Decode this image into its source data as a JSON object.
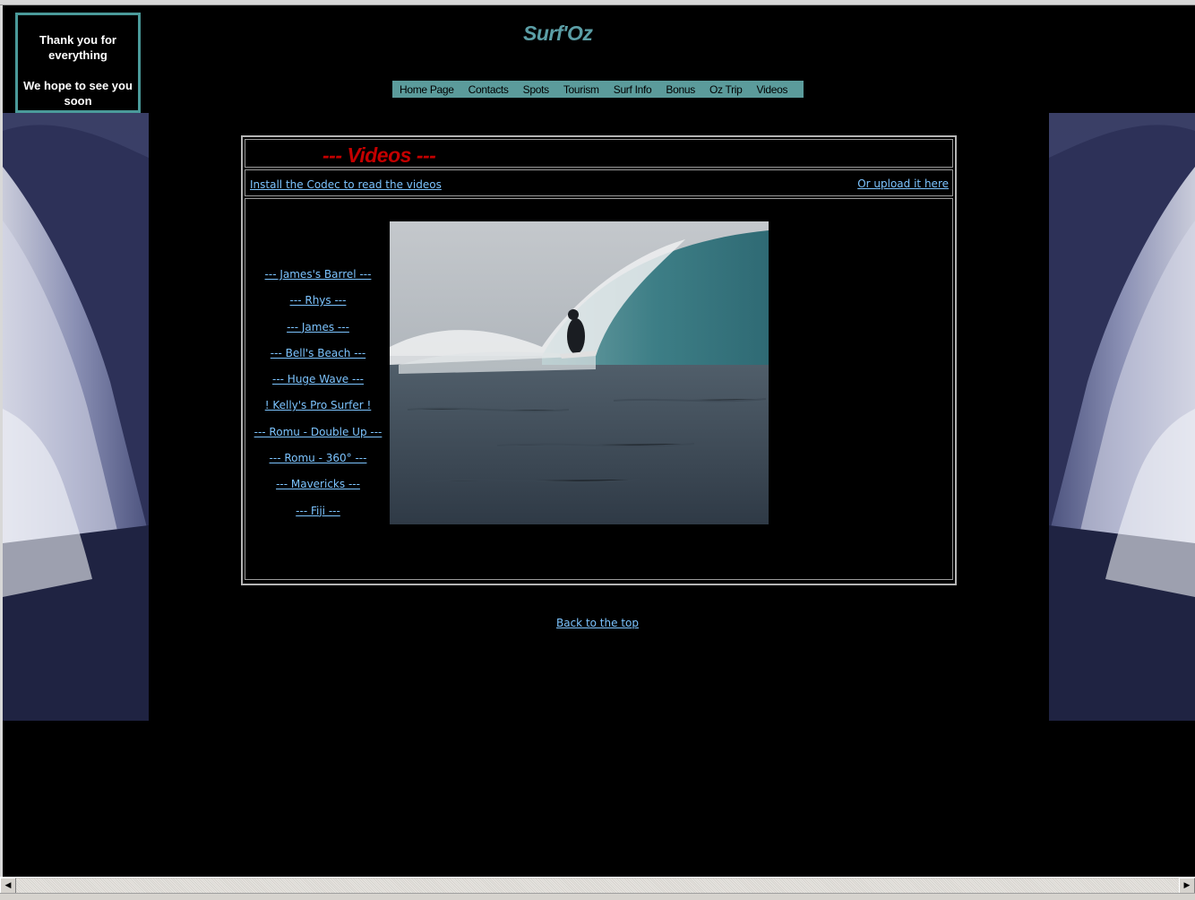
{
  "site": {
    "title": "Surf'Oz",
    "notice_line1": "Thank you for everything",
    "notice_line2": "We hope to see you soon"
  },
  "nav": {
    "items": [
      {
        "label": "Home Page"
      },
      {
        "label": "Contacts"
      },
      {
        "label": "Spots"
      },
      {
        "label": "Tourism"
      },
      {
        "label": "Surf Info"
      },
      {
        "label": "Bonus"
      },
      {
        "label": "Oz Trip"
      },
      {
        "label": "Videos"
      }
    ]
  },
  "section": {
    "heading": "--- Videos ---",
    "codec_link": "Install the Codec to read the videos",
    "upload_link": "Or upload it here"
  },
  "videos": [
    {
      "label": "--- James's Barrel ---"
    },
    {
      "label": "--- Rhys ---"
    },
    {
      "label": "--- James ---"
    },
    {
      "label": "--- Bell's Beach ---"
    },
    {
      "label": "--- Huge Wave ---"
    },
    {
      "label": "! Kelly's Pro Surfer !"
    },
    {
      "label": "--- Romu - Double Up ---"
    },
    {
      "label": "--- Romu - 360° ---"
    },
    {
      "label": "--- Mavericks ---"
    },
    {
      "label": "--- Fiji ---"
    }
  ],
  "footer": {
    "back_to_top": "Back to the top"
  },
  "scrollbar": {
    "left_arrow": "◀",
    "right_arrow": "▶"
  },
  "colors": {
    "accent_teal": "#5b9ea6",
    "nav_bg": "#5b9b9b",
    "heading_red": "#c40000",
    "link_blue": "#7cc4ff"
  }
}
